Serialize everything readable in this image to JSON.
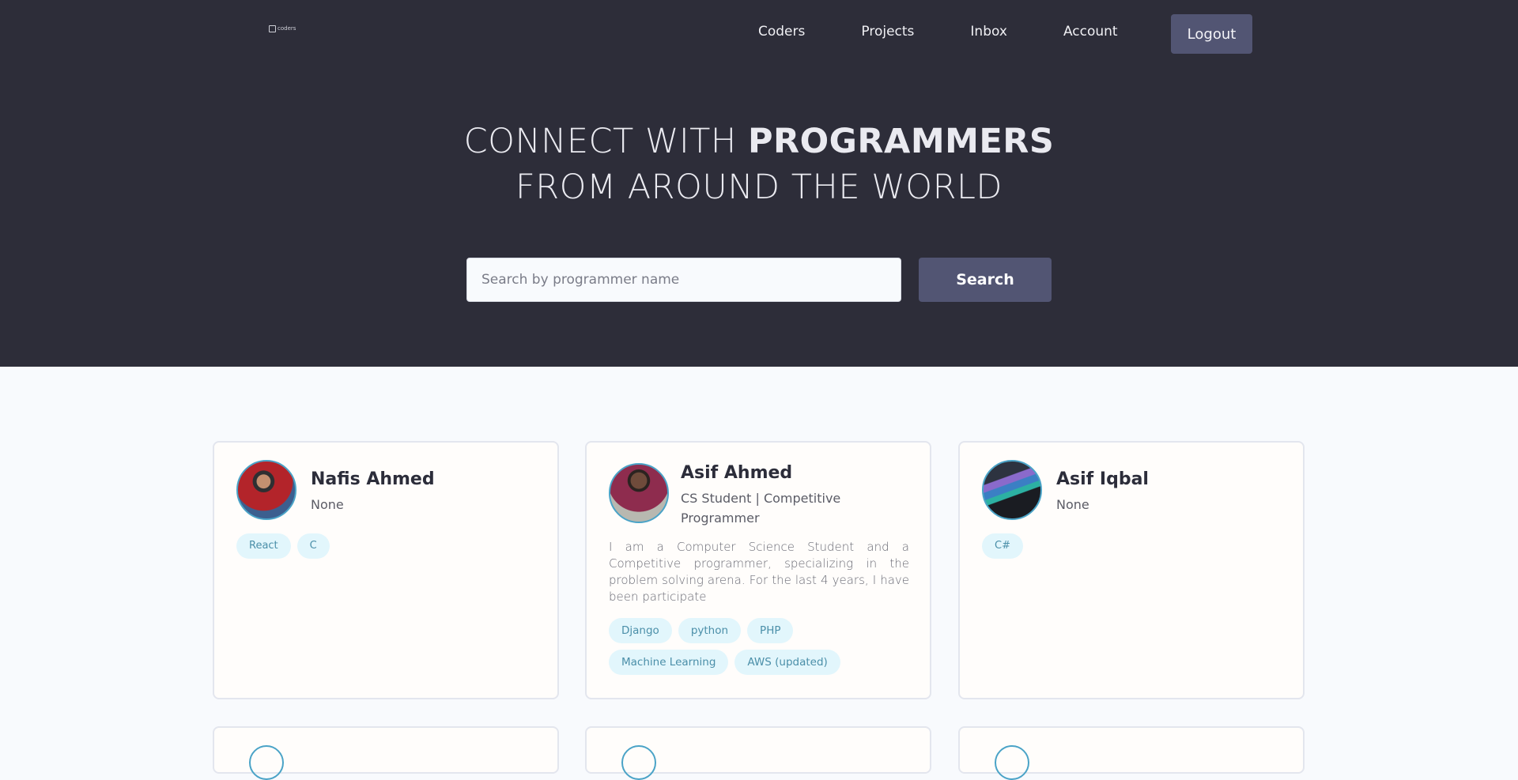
{
  "nav": {
    "logo_text": "coders",
    "links": [
      "Coders",
      "Projects",
      "Inbox",
      "Account"
    ],
    "logout_label": "Logout"
  },
  "hero": {
    "line1_prefix": "CONNECT WITH ",
    "line1_strong": "PROGRAMMERS",
    "line2": "FROM AROUND THE WORLD"
  },
  "search": {
    "placeholder": "Search by programmer name",
    "value": "",
    "button_label": "Search"
  },
  "profiles": [
    {
      "name": "Nafis Ahmed",
      "subtitle": "None",
      "bio": "",
      "tags": [
        "React",
        "C"
      ]
    },
    {
      "name": "Asif Ahmed",
      "subtitle": "CS Student | Competitive Programmer",
      "bio": "I am a Computer Science Student and a Competitive programmer, specializing in the problem solving arena. For the last 4 years, I have been participate",
      "tags": [
        "Django",
        "python",
        "PHP",
        "Machine Learning",
        "AWS (updated)"
      ]
    },
    {
      "name": "Asif Iqbal",
      "subtitle": "None",
      "bio": "",
      "tags": [
        "C#"
      ]
    }
  ],
  "colors": {
    "header_bg": "#2d2d39",
    "button_bg": "#525573",
    "tag_bg": "#e2f6fc",
    "tag_text": "#4b8fa9",
    "avatar_ring": "#4aa3c7"
  }
}
